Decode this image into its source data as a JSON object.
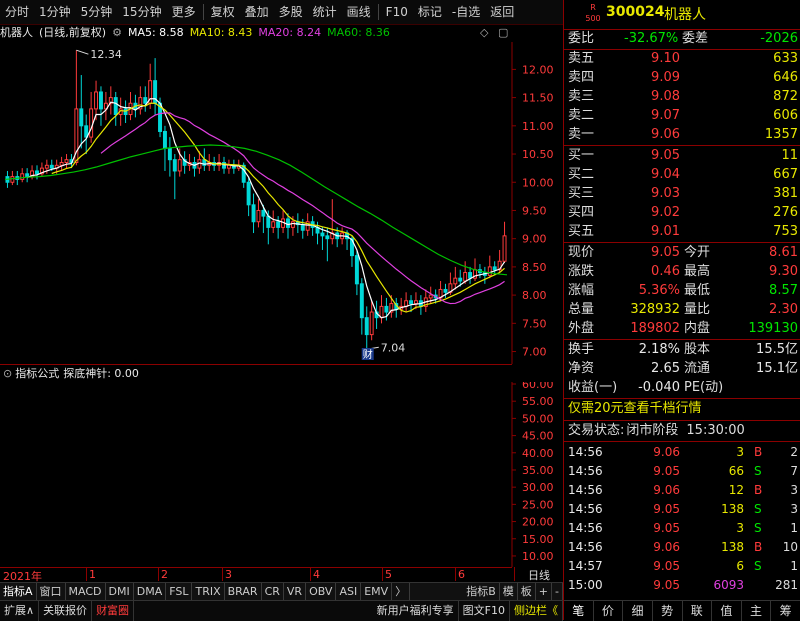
{
  "toolbar": {
    "items": [
      "分时",
      "1分钟",
      "5分钟",
      "15分钟",
      "更多",
      "复权",
      "叠加",
      "多股",
      "统计",
      "画线",
      "F10",
      "标记",
      "-自选",
      "返回"
    ]
  },
  "chart_header": {
    "stock_name": "机器人",
    "mode": "(日线,前复权)",
    "ma5": "MA5: 8.58",
    "ma10": "MA10: 8.43",
    "ma20": "MA20: 8.24",
    "ma60": "MA60: 8.36"
  },
  "colors": {
    "up": "#ff3b3b",
    "down": "#00d8d8",
    "ma5": "#ffffff",
    "ma10": "#e8e800",
    "ma20": "#e040e0",
    "ma60": "#00c000",
    "axis": "#8b0000"
  },
  "chart_data": {
    "type": "candlestick",
    "price_axis": {
      "ticks": [
        "12.00",
        "11.50",
        "11.00",
        "10.50",
        "10.00",
        "9.50",
        "9.00",
        "8.50",
        "8.00",
        "7.50",
        "7.00"
      ],
      "ylim": [
        6.85,
        12.45
      ]
    },
    "annotations": {
      "high_label": "12.34",
      "low_label": "7.04",
      "event_marker": "财"
    },
    "candles": [
      [
        10.1,
        10.0,
        10.2,
        9.9
      ],
      [
        10.0,
        10.1,
        10.2,
        9.95
      ],
      [
        10.1,
        10.05,
        10.2,
        9.95
      ],
      [
        10.05,
        10.15,
        10.25,
        10.0
      ],
      [
        10.15,
        10.1,
        10.25,
        10.0
      ],
      [
        10.1,
        10.2,
        10.3,
        10.05
      ],
      [
        10.2,
        10.15,
        10.3,
        10.05
      ],
      [
        10.15,
        10.25,
        10.35,
        10.1
      ],
      [
        10.25,
        10.3,
        10.4,
        10.15
      ],
      [
        10.3,
        10.25,
        10.4,
        10.2
      ],
      [
        10.25,
        10.3,
        10.4,
        10.15
      ],
      [
        10.3,
        10.35,
        10.45,
        10.2
      ],
      [
        10.35,
        10.4,
        10.5,
        10.25
      ],
      [
        10.4,
        10.35,
        10.5,
        10.25
      ],
      [
        10.35,
        11.3,
        12.34,
        10.3
      ],
      [
        11.3,
        11.0,
        11.9,
        10.6
      ],
      [
        11.0,
        10.8,
        11.2,
        10.5
      ],
      [
        10.8,
        11.3,
        11.6,
        10.7
      ],
      [
        11.3,
        11.6,
        11.8,
        11.1
      ],
      [
        11.6,
        11.3,
        11.7,
        11.0
      ],
      [
        11.3,
        11.4,
        11.6,
        11.1
      ],
      [
        11.4,
        11.5,
        11.7,
        11.2
      ],
      [
        11.5,
        11.2,
        11.6,
        11.0
      ],
      [
        11.2,
        11.3,
        11.5,
        11.0
      ],
      [
        11.3,
        11.2,
        11.45,
        11.05
      ],
      [
        11.2,
        11.4,
        11.6,
        11.1
      ],
      [
        11.4,
        11.3,
        11.55,
        11.15
      ],
      [
        11.3,
        11.5,
        11.7,
        11.2
      ],
      [
        11.5,
        11.4,
        11.7,
        11.25
      ],
      [
        11.4,
        11.8,
        12.1,
        11.3
      ],
      [
        11.8,
        11.4,
        12.2,
        11.2
      ],
      [
        11.4,
        10.9,
        11.5,
        10.8
      ],
      [
        10.9,
        10.6,
        11.0,
        10.2
      ],
      [
        10.6,
        10.4,
        10.8,
        10.1
      ],
      [
        10.4,
        10.2,
        10.5,
        9.7
      ],
      [
        10.2,
        10.4,
        10.6,
        10.1
      ],
      [
        10.4,
        10.3,
        10.55,
        10.15
      ],
      [
        10.3,
        10.35,
        10.5,
        10.2
      ],
      [
        10.35,
        10.25,
        10.45,
        10.1
      ],
      [
        10.25,
        10.4,
        10.55,
        10.15
      ],
      [
        10.4,
        10.3,
        10.6,
        10.2
      ],
      [
        10.3,
        10.35,
        10.5,
        10.2
      ],
      [
        10.35,
        10.3,
        10.45,
        10.2
      ],
      [
        10.3,
        10.35,
        10.5,
        10.2
      ],
      [
        10.35,
        10.25,
        10.45,
        10.15
      ],
      [
        10.25,
        10.3,
        10.4,
        10.15
      ],
      [
        10.3,
        10.25,
        10.4,
        10.15
      ],
      [
        10.25,
        10.3,
        10.4,
        10.2
      ],
      [
        10.3,
        10.0,
        10.35,
        9.9
      ],
      [
        10.0,
        9.6,
        10.1,
        9.4
      ],
      [
        9.6,
        9.3,
        9.8,
        9.1
      ],
      [
        9.3,
        9.5,
        9.7,
        9.2
      ],
      [
        9.5,
        9.4,
        9.6,
        9.1
      ],
      [
        9.4,
        9.2,
        9.5,
        8.9
      ],
      [
        9.2,
        9.3,
        9.5,
        9.1
      ],
      [
        9.3,
        9.2,
        9.4,
        9.0
      ],
      [
        9.2,
        9.35,
        9.5,
        9.1
      ],
      [
        9.35,
        9.2,
        9.45,
        9.0
      ],
      [
        9.2,
        9.3,
        9.4,
        9.05
      ],
      [
        9.3,
        9.25,
        9.45,
        9.1
      ],
      [
        9.25,
        9.15,
        9.35,
        9.0
      ],
      [
        9.15,
        9.3,
        9.45,
        9.05
      ],
      [
        9.3,
        9.2,
        9.4,
        9.05
      ],
      [
        9.2,
        9.1,
        9.3,
        8.9
      ],
      [
        9.1,
        9.05,
        9.2,
        8.8
      ],
      [
        9.05,
        9.0,
        9.2,
        8.6
      ],
      [
        9.0,
        9.1,
        9.7,
        8.9
      ],
      [
        9.1,
        9.0,
        9.2,
        8.85
      ],
      [
        9.0,
        9.1,
        9.2,
        8.9
      ],
      [
        9.1,
        9.0,
        9.15,
        8.8
      ],
      [
        9.0,
        8.7,
        9.05,
        8.5
      ],
      [
        8.7,
        8.2,
        8.8,
        8.0
      ],
      [
        8.2,
        7.6,
        8.3,
        7.3
      ],
      [
        7.6,
        7.3,
        7.8,
        7.04
      ],
      [
        7.3,
        7.7,
        7.9,
        7.2
      ],
      [
        7.7,
        7.6,
        7.9,
        7.4
      ],
      [
        7.6,
        7.8,
        8.0,
        7.5
      ],
      [
        7.8,
        7.7,
        7.95,
        7.55
      ],
      [
        7.7,
        7.85,
        8.0,
        7.6
      ],
      [
        7.85,
        7.75,
        7.95,
        7.6
      ],
      [
        7.75,
        7.8,
        7.95,
        7.65
      ],
      [
        7.8,
        7.9,
        8.05,
        7.7
      ],
      [
        7.9,
        7.85,
        8.0,
        7.7
      ],
      [
        7.85,
        7.9,
        8.05,
        7.75
      ],
      [
        7.9,
        7.8,
        8.0,
        7.65
      ],
      [
        7.8,
        7.95,
        8.1,
        7.7
      ],
      [
        7.95,
        8.0,
        8.15,
        7.85
      ],
      [
        8.0,
        7.95,
        8.1,
        7.85
      ],
      [
        7.95,
        8.1,
        8.25,
        7.9
      ],
      [
        8.1,
        8.05,
        8.2,
        7.95
      ],
      [
        8.05,
        8.2,
        8.4,
        8.0
      ],
      [
        8.2,
        8.3,
        8.5,
        8.1
      ],
      [
        8.3,
        8.25,
        8.45,
        8.15
      ],
      [
        8.25,
        8.4,
        8.6,
        8.2
      ],
      [
        8.4,
        8.3,
        8.5,
        8.2
      ],
      [
        8.3,
        8.45,
        8.65,
        8.25
      ],
      [
        8.45,
        8.4,
        8.55,
        8.3
      ],
      [
        8.4,
        8.35,
        8.5,
        8.2
      ],
      [
        8.35,
        8.5,
        8.7,
        8.3
      ],
      [
        8.5,
        8.45,
        8.6,
        8.35
      ],
      [
        8.45,
        8.6,
        8.8,
        8.4
      ],
      [
        8.6,
        9.05,
        9.3,
        8.57
      ]
    ],
    "ma60": [
      10.05,
      10.07,
      10.09,
      10.1,
      10.12,
      10.15,
      10.18,
      10.22,
      10.27,
      10.33,
      10.39,
      10.45,
      10.5,
      10.55,
      10.6,
      10.62,
      10.64,
      10.65,
      10.66,
      10.65,
      10.63,
      10.6,
      10.55,
      10.48,
      10.4,
      10.3,
      10.18,
      10.05,
      9.92,
      9.8,
      9.68,
      9.56,
      9.45,
      9.33,
      9.2,
      9.08,
      8.96,
      8.84,
      8.72,
      8.62,
      8.53,
      8.46,
      8.41,
      8.38,
      8.36
    ]
  },
  "indicator": {
    "name": "指标公式",
    "label": "探底神针: 0.00",
    "ticks": [
      "60.00",
      "55.00",
      "50.00",
      "45.00",
      "40.00",
      "35.00",
      "30.00",
      "25.00",
      "20.00",
      "15.00",
      "10.00"
    ]
  },
  "date_axis": {
    "year": "2021年",
    "months": [
      "1",
      "2",
      "3",
      "4",
      "5",
      "6"
    ],
    "period": "日线"
  },
  "tabs": [
    "指标A",
    "窗口",
    "MACD",
    "DMI",
    "DMA",
    "FSL",
    "TRIX",
    "BRAR",
    "CR",
    "VR",
    "OBV",
    "ASI",
    "EMV",
    "〉",
    "指标B",
    "模",
    "板",
    "+",
    "-"
  ],
  "bottombar": {
    "left": [
      "扩展∧",
      "关联报价",
      "财富圈"
    ],
    "right": [
      "新用户福利专享",
      "图文F10",
      "侧边栏《"
    ]
  },
  "quote": {
    "badge_top": "R",
    "badge_bottom": "500",
    "code": "300024",
    "name": "机器人",
    "weibi_label": "委比",
    "weibi": "-32.67%",
    "weicha_label": "委差",
    "weicha": "-2026",
    "asks": [
      {
        "label": "卖五",
        "price": "9.10",
        "vol": "633"
      },
      {
        "label": "卖四",
        "price": "9.09",
        "vol": "646"
      },
      {
        "label": "卖三",
        "price": "9.08",
        "vol": "872"
      },
      {
        "label": "卖二",
        "price": "9.07",
        "vol": "606"
      },
      {
        "label": "卖一",
        "price": "9.06",
        "vol": "1357"
      }
    ],
    "bids": [
      {
        "label": "买一",
        "price": "9.05",
        "vol": "11"
      },
      {
        "label": "买二",
        "price": "9.04",
        "vol": "667"
      },
      {
        "label": "买三",
        "price": "9.03",
        "vol": "381"
      },
      {
        "label": "买四",
        "price": "9.02",
        "vol": "276"
      },
      {
        "label": "买五",
        "price": "9.01",
        "vol": "753"
      }
    ],
    "stats": [
      {
        "l1": "现价",
        "v1": "9.05",
        "l2": "今开",
        "v2": "8.61"
      },
      {
        "l1": "涨跌",
        "v1": "0.46",
        "l2": "最高",
        "v2": "9.30"
      },
      {
        "l1": "涨幅",
        "v1": "5.36%",
        "l2": "最低",
        "v2": "8.57"
      },
      {
        "l1": "总量",
        "v1": "328932",
        "l2": "量比",
        "v2": "2.30"
      },
      {
        "l1": "外盘",
        "v1": "189802",
        "l2": "内盘",
        "v2": "139130"
      }
    ],
    "stats2": [
      {
        "l1": "换手",
        "v1": "2.18%",
        "l2": "股本",
        "v2": "15.5亿"
      },
      {
        "l1": "净资",
        "v1": "2.65",
        "l2": "流通",
        "v2": "15.1亿"
      },
      {
        "l1": "收益(一)",
        "v1": "-0.040",
        "l2": "PE(动)",
        "v2": ""
      }
    ],
    "promo": "仅需20元查看千档行情",
    "trade_state_label": "交易状态:",
    "trade_state": "闭市阶段",
    "trade_time": "15:30:00",
    "ticks": [
      {
        "t": "14:56",
        "p": "9.06",
        "v": "3",
        "bs": "B",
        "n": "2"
      },
      {
        "t": "14:56",
        "p": "9.05",
        "v": "66",
        "bs": "S",
        "n": "7"
      },
      {
        "t": "14:56",
        "p": "9.06",
        "v": "12",
        "bs": "B",
        "n": "3"
      },
      {
        "t": "14:56",
        "p": "9.05",
        "v": "138",
        "bs": "S",
        "n": "3"
      },
      {
        "t": "14:56",
        "p": "9.05",
        "v": "3",
        "bs": "S",
        "n": "1"
      },
      {
        "t": "14:56",
        "p": "9.06",
        "v": "138",
        "bs": "B",
        "n": "10"
      },
      {
        "t": "14:57",
        "p": "9.05",
        "v": "6",
        "bs": "S",
        "n": "1"
      },
      {
        "t": "15:00",
        "p": "9.05",
        "v": "6093",
        "bs": "",
        "n": "281"
      }
    ],
    "bottom_tabs": [
      "笔",
      "价",
      "细",
      "势",
      "联",
      "值",
      "主",
      "筹"
    ]
  }
}
